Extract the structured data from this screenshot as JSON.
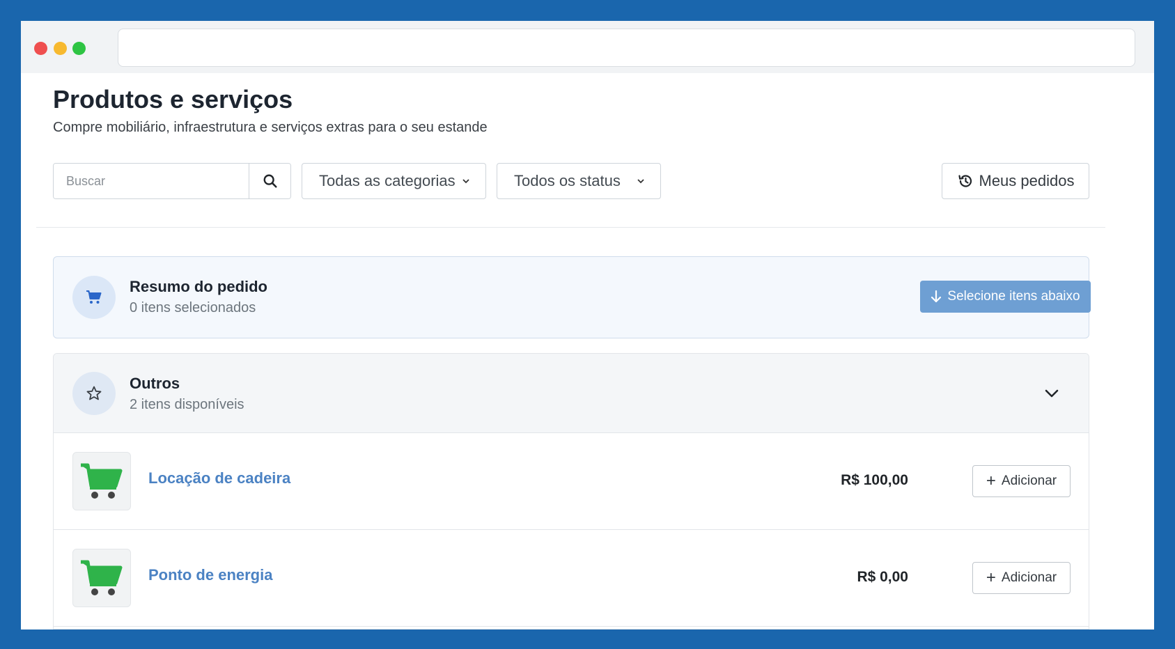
{
  "page": {
    "title": "Produtos e serviços",
    "subtitle": "Compre mobiliário, infraestrutura e serviços extras para o seu estande"
  },
  "filters": {
    "search_placeholder": "Buscar",
    "category_selected": "Todas as categorias",
    "status_selected": "Todos os status",
    "orders_button": "Meus pedidos"
  },
  "summary": {
    "title": "Resumo do pedido",
    "subtitle": "0 itens selecionados",
    "action_label": "Selecione itens abaixo"
  },
  "category": {
    "title": "Outros",
    "subtitle": "2 itens disponíveis",
    "items": [
      {
        "name": "Locação de cadeira",
        "price": "R$ 100,00",
        "add_label": "Adicionar"
      },
      {
        "name": "Ponto de energia",
        "price": "R$ 0,00",
        "add_label": "Adicionar"
      }
    ]
  },
  "colors": {
    "frame": "#1a66ad",
    "accent_link": "#4b82c3",
    "primary_button": "#6e9fd3",
    "cart_green": "#2fb34a"
  },
  "icons": [
    "search-icon",
    "chevron-down-icon",
    "history-icon",
    "cart-icon",
    "arrow-down-icon",
    "star-icon",
    "plus-icon"
  ]
}
